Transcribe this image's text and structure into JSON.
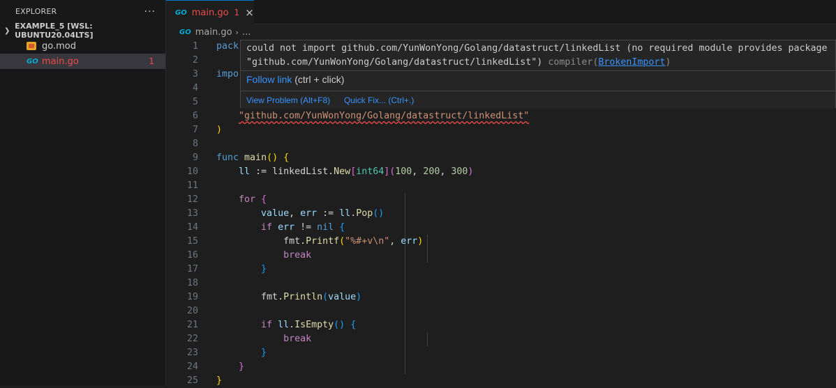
{
  "sidebar": {
    "title": "EXPLORER",
    "more": "···",
    "folder": "EXAMPLE_5 [WSL: UBUNTU20.04LTS]",
    "files": [
      {
        "name": "go.mod",
        "icon": "go-mod-icon"
      },
      {
        "name": "main.go",
        "icon": "go-file-icon",
        "problems": "1"
      }
    ]
  },
  "tab": {
    "name": "main.go",
    "problems": "1",
    "close": "×",
    "icon_text": "GO"
  },
  "breadcrumb": {
    "file": "main.go",
    "rest": "..."
  },
  "hover": {
    "message_line1": "could not import github.com/YunWonYong/Golang/datastruct/linkedList (no required module provides package",
    "message_line2": "\"github.com/YunWonYong/Golang/datastruct/linkedList\")",
    "source": "compiler",
    "code": "BrokenImport",
    "follow_link": "Follow link",
    "follow_hint": "(ctrl + click)",
    "view_problem": "View Problem (Alt+F8)",
    "quick_fix": "Quick Fix... (Ctrl+.)"
  },
  "editor": {
    "line_numbers": [
      "1",
      "2",
      "3",
      "4",
      "5",
      "6",
      "7",
      "8",
      "9",
      "10",
      "11",
      "12",
      "13",
      "14",
      "15",
      "16",
      "17",
      "18",
      "19",
      "20",
      "21",
      "22",
      "23",
      "24",
      "25"
    ],
    "visible_fragments": {
      "line1": "pack",
      "line3": "impo"
    },
    "import_path": "\"github.com/YunWonYong/Golang/datastruct/linkedList\""
  },
  "colors": {
    "accent": "#0078d4",
    "error": "#f14c4c",
    "link": "#3794ff"
  }
}
